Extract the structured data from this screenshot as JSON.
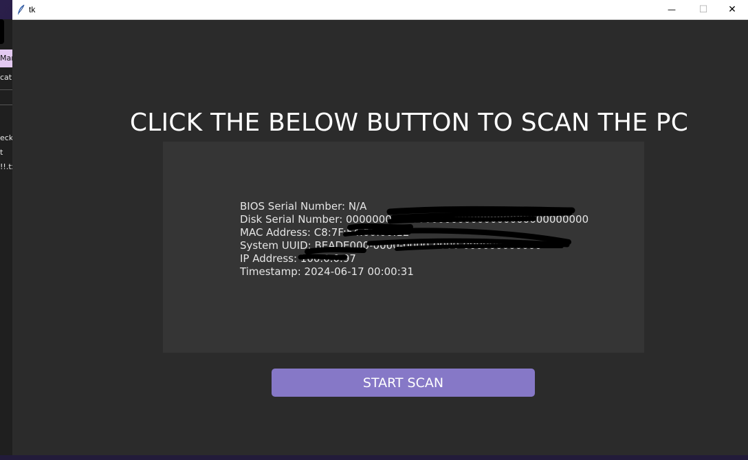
{
  "window": {
    "title": "tk",
    "minimize_glyph": "—",
    "maximize_glyph": "☐",
    "close_glyph": "✕"
  },
  "background_app": {
    "pill_text": "Man",
    "line1": "cati",
    "line2": "ecke",
    "line3": "t",
    "line4": "!!.tx"
  },
  "main": {
    "heading": "CLICK THE BELOW BUTTON TO SCAN THE PC",
    "info": {
      "bios": "BIOS Serial Number: N/A",
      "disk": "Disk Serial Number: 0000000000000000000000000000000000000",
      "mac": "MAC Address: C8:7F:54:00:00:12",
      "uuid": "System UUID: BEADE000-0000-0000-0000-000000000000",
      "ip": "IP Address: 100.0.0.97",
      "timestamp": "Timestamp: 2024-06-17 00:00:31"
    },
    "scan_button_label": "START SCAN"
  },
  "colors": {
    "window_bg": "#2b2b2b",
    "panel_bg": "#353535",
    "button_bg": "#8678c7",
    "heading_text": "#ffffff"
  },
  "icons": {
    "app": "feather-icon"
  }
}
